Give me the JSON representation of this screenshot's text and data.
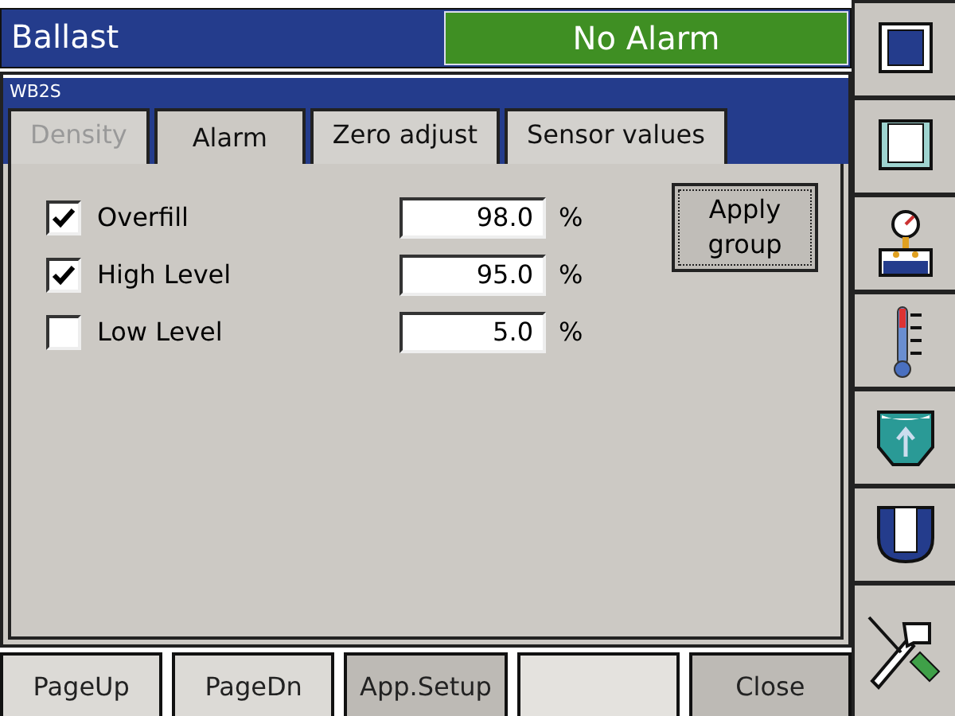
{
  "header": {
    "title": "Ballast",
    "alarm_status": "No Alarm"
  },
  "subtitle": "WB2S",
  "tabs": [
    {
      "label": "Density",
      "selected": false,
      "disabled": true
    },
    {
      "label": "Alarm",
      "selected": true,
      "disabled": false
    },
    {
      "label": "Zero adjust",
      "selected": false,
      "disabled": false
    },
    {
      "label": "Sensor values",
      "selected": false,
      "disabled": false
    }
  ],
  "alarms": [
    {
      "label": "Overfill",
      "checked": true,
      "value": "98.0",
      "unit": "%"
    },
    {
      "label": "High Level",
      "checked": true,
      "value": "95.0",
      "unit": "%"
    },
    {
      "label": "Low Level",
      "checked": false,
      "value": "5.0",
      "unit": "%"
    }
  ],
  "apply_button": {
    "line_1": "Apply",
    "line_2": "group"
  },
  "footer_buttons": [
    {
      "kind": "light",
      "label": "PageUp"
    },
    {
      "kind": "light",
      "label": "PageDn"
    },
    {
      "kind": "dark",
      "label": "App.Setup"
    },
    {
      "kind": "blank"
    },
    {
      "kind": "dark",
      "label": "Close"
    }
  ],
  "side_tools": [
    {
      "kind": "full-tank"
    },
    {
      "kind": "empty-tank"
    },
    {
      "kind": "gauge"
    },
    {
      "kind": "thermometer"
    },
    {
      "kind": "shield"
    },
    {
      "kind": "hull"
    },
    {
      "kind": "wrench"
    }
  ]
}
